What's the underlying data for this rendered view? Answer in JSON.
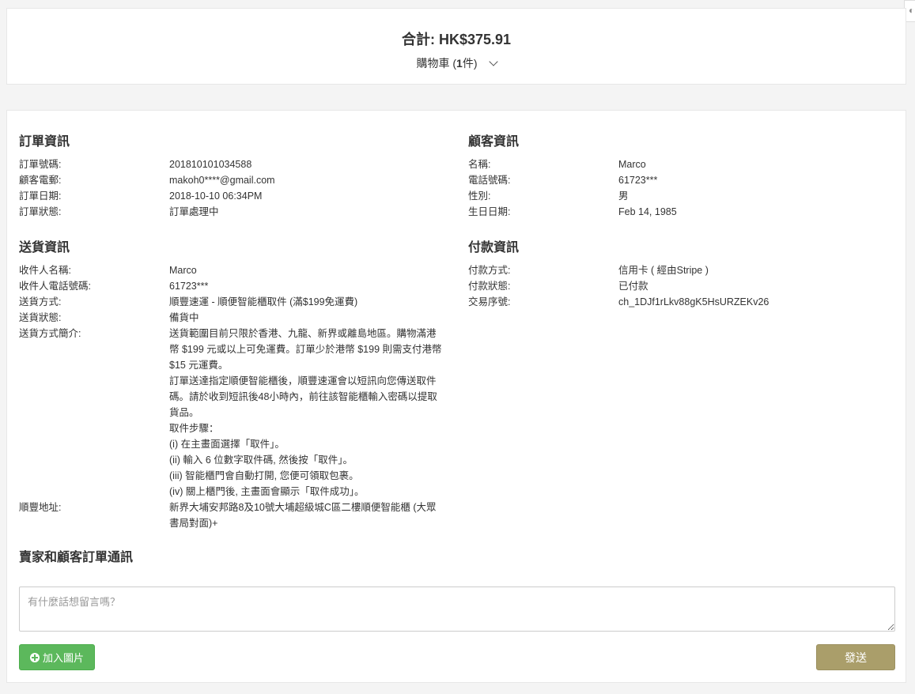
{
  "summary": {
    "total_label": "合計:",
    "total_value": "HK$375.91",
    "cart_label": "購物車 (",
    "cart_count": "1",
    "cart_suffix": "件)"
  },
  "order_info": {
    "title": "訂單資訊",
    "rows": [
      {
        "label": "訂單號碼:",
        "value": "201810101034588"
      },
      {
        "label": "顧客電郵:",
        "value": "makoh0****@gmail.com"
      },
      {
        "label": "訂單日期:",
        "value": "2018-10-10 06:34PM"
      },
      {
        "label": "訂單狀態:",
        "value": "訂單處理中"
      }
    ]
  },
  "customer_info": {
    "title": "顧客資訊",
    "rows": [
      {
        "label": "名稱:",
        "value": "Marco"
      },
      {
        "label": "電話號碼:",
        "value": "61723***"
      },
      {
        "label": "性別:",
        "value": "男"
      },
      {
        "label": "生日日期:",
        "value": "Feb 14, 1985"
      }
    ]
  },
  "delivery_info": {
    "title": "送貨資訊",
    "rows": [
      {
        "label": "收件人名稱:",
        "value": "Marco"
      },
      {
        "label": "收件人電話號碼:",
        "value": "61723***"
      },
      {
        "label": "送貨方式:",
        "value": "順豐速運 - 順便智能櫃取件 (滿$199免運費)"
      },
      {
        "label": "送貨狀態:",
        "value": "備貨中"
      }
    ],
    "description_label": "送貨方式簡介:",
    "description_lines": [
      "送貨範圍目前只限於香港、九龍、新界或離島地區。購物滿港幣 $199 元或以上可免運費。訂單少於港幣 $199 則需支付港幣 $15 元運費。",
      "訂單送達指定順便智能櫃後，順豐速運會以短訊向您傳送取件碼。請於收到短訊後48小時內，前往該智能櫃輸入密碼以提取貨品。",
      "取件步驟：",
      "(i) 在主畫面選擇「取件」。",
      "(ii) 輸入 6 位數字取件碼, 然後按「取件」。",
      "(iii) 智能櫃門會自動打開, 您便可領取包裹。",
      "(iv) 關上櫃門後, 主畫面會顯示「取件成功」。"
    ],
    "address_label": "順豐地址:",
    "address_value": "新界大埔安邦路8及10號大埔超級城C區二樓順便智能櫃 (大眾書局對面)+"
  },
  "payment_info": {
    "title": "付款資訊",
    "rows": [
      {
        "label": "付款方式:",
        "value": "信用卡 ( 經由Stripe )"
      },
      {
        "label": "付款狀態:",
        "value": "已付款"
      },
      {
        "label": "交易序號:",
        "value": "ch_1DJf1rLkv88gK5HsURZEKv26"
      }
    ]
  },
  "messages": {
    "title": "賣家和顧客訂單通訊",
    "placeholder": "有什麼話想留言嗎？",
    "add_image_label": "加入圖片",
    "send_label": "發送"
  },
  "colors": {
    "add_image_bg": "#5cb85c",
    "send_bg": "#aa9e6a"
  }
}
